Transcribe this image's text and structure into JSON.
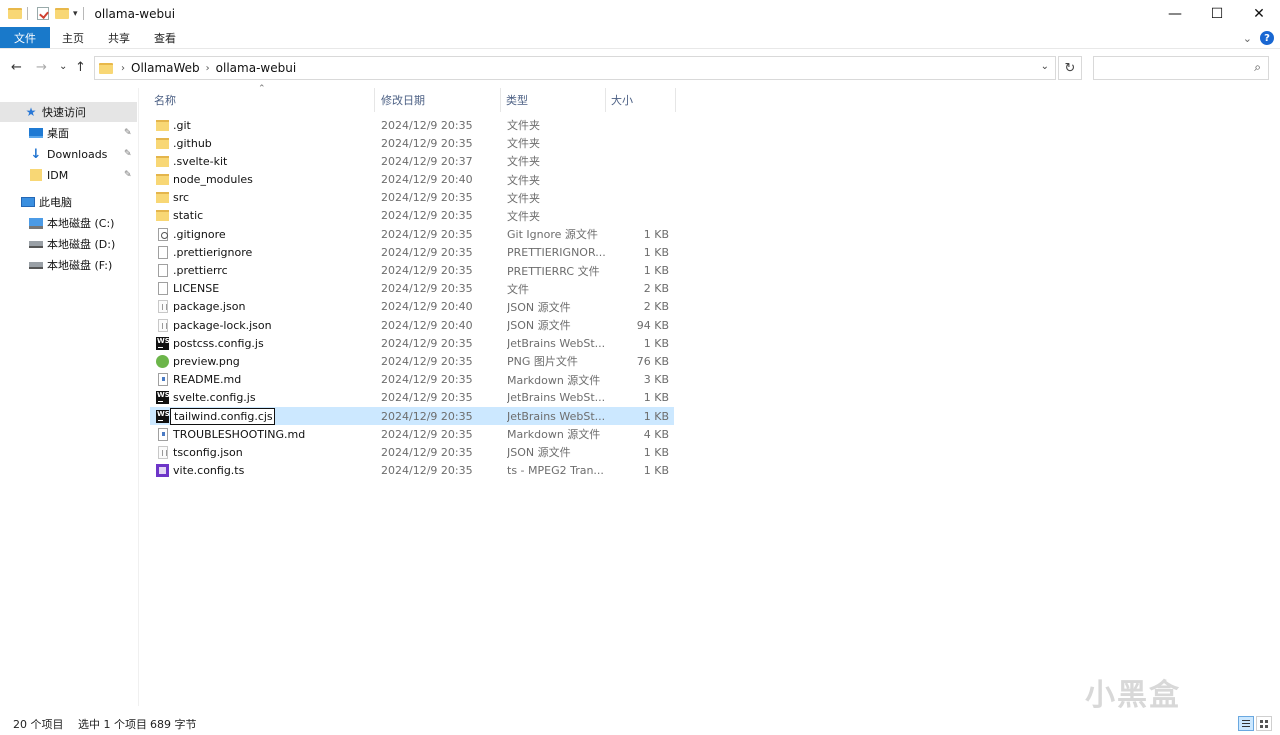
{
  "window": {
    "title": "ollama-webui"
  },
  "window_controls": {
    "minimize": "—",
    "maximize": "☐",
    "close": "✕"
  },
  "ribbon": {
    "tabs": [
      "文件",
      "主页",
      "共享",
      "查看"
    ],
    "expand": "⌄",
    "help": "?"
  },
  "nav": {
    "back": "←",
    "forward": "→",
    "recent": "⌄",
    "up": "↑",
    "breadcrumbs": [
      "OllamaWeb",
      "ollama-webui"
    ],
    "dropdown": "⌄",
    "refresh": "↻",
    "search_placeholder": ""
  },
  "sidebar": {
    "quick_access": "快速访问",
    "items": [
      {
        "label": "桌面",
        "icon": "desktop-icon"
      },
      {
        "label": "Downloads",
        "icon": "download-icon"
      },
      {
        "label": "IDM",
        "icon": "folder-icon"
      }
    ],
    "this_pc": "此电脑",
    "drives": [
      "本地磁盘 (C:)",
      "本地磁盘 (D:)",
      "本地磁盘 (F:)"
    ]
  },
  "columns": {
    "name": "名称",
    "date": "修改日期",
    "type": "类型",
    "size": "大小"
  },
  "files": [
    {
      "name": ".git",
      "date": "2024/12/9 20:35",
      "type": "文件夹",
      "size": "",
      "icon": "folder"
    },
    {
      "name": ".github",
      "date": "2024/12/9 20:35",
      "type": "文件夹",
      "size": "",
      "icon": "folder"
    },
    {
      "name": ".svelte-kit",
      "date": "2024/12/9 20:37",
      "type": "文件夹",
      "size": "",
      "icon": "folder"
    },
    {
      "name": "node_modules",
      "date": "2024/12/9 20:40",
      "type": "文件夹",
      "size": "",
      "icon": "folder"
    },
    {
      "name": "src",
      "date": "2024/12/9 20:35",
      "type": "文件夹",
      "size": "",
      "icon": "folder"
    },
    {
      "name": "static",
      "date": "2024/12/9 20:35",
      "type": "文件夹",
      "size": "",
      "icon": "folder"
    },
    {
      "name": ".gitignore",
      "date": "2024/12/9 20:35",
      "type": "Git Ignore 源文件",
      "size": "1 KB",
      "icon": "gear"
    },
    {
      "name": ".prettierignore",
      "date": "2024/12/9 20:35",
      "type": "PRETTIERIGNOR...",
      "size": "1 KB",
      "icon": "doc"
    },
    {
      "name": ".prettierrc",
      "date": "2024/12/9 20:35",
      "type": "PRETTIERRC 文件",
      "size": "1 KB",
      "icon": "doc"
    },
    {
      "name": "LICENSE",
      "date": "2024/12/9 20:35",
      "type": "文件",
      "size": "2 KB",
      "icon": "doc"
    },
    {
      "name": "package.json",
      "date": "2024/12/9 20:40",
      "type": "JSON 源文件",
      "size": "2 KB",
      "icon": "json"
    },
    {
      "name": "package-lock.json",
      "date": "2024/12/9 20:40",
      "type": "JSON 源文件",
      "size": "94 KB",
      "icon": "json"
    },
    {
      "name": "postcss.config.js",
      "date": "2024/12/9 20:35",
      "type": "JetBrains WebSt...",
      "size": "1 KB",
      "icon": "ws"
    },
    {
      "name": "preview.png",
      "date": "2024/12/9 20:35",
      "type": "PNG 图片文件",
      "size": "76 KB",
      "icon": "png"
    },
    {
      "name": "README.md",
      "date": "2024/12/9 20:35",
      "type": "Markdown 源文件",
      "size": "3 KB",
      "icon": "md"
    },
    {
      "name": "svelte.config.js",
      "date": "2024/12/9 20:35",
      "type": "JetBrains WebSt...",
      "size": "1 KB",
      "icon": "ws"
    },
    {
      "name": "tailwind.config.cjs",
      "date": "2024/12/9 20:35",
      "type": "JetBrains WebSt...",
      "size": "1 KB",
      "icon": "ws",
      "selected": true,
      "renaming": true
    },
    {
      "name": "TROUBLESHOOTING.md",
      "date": "2024/12/9 20:35",
      "type": "Markdown 源文件",
      "size": "4 KB",
      "icon": "md"
    },
    {
      "name": "tsconfig.json",
      "date": "2024/12/9 20:35",
      "type": "JSON 源文件",
      "size": "1 KB",
      "icon": "json"
    },
    {
      "name": "vite.config.ts",
      "date": "2024/12/9 20:35",
      "type": "ts - MPEG2 Tran...",
      "size": "1 KB",
      "icon": "ts"
    }
  ],
  "status": {
    "count": "20 个项目",
    "selected": "选中 1 个项目",
    "size": "689 字节"
  },
  "watermark": "小黑盒",
  "colors": {
    "accent": "#1979ca",
    "selection": "#cce8ff",
    "header_text": "#4d6185"
  }
}
